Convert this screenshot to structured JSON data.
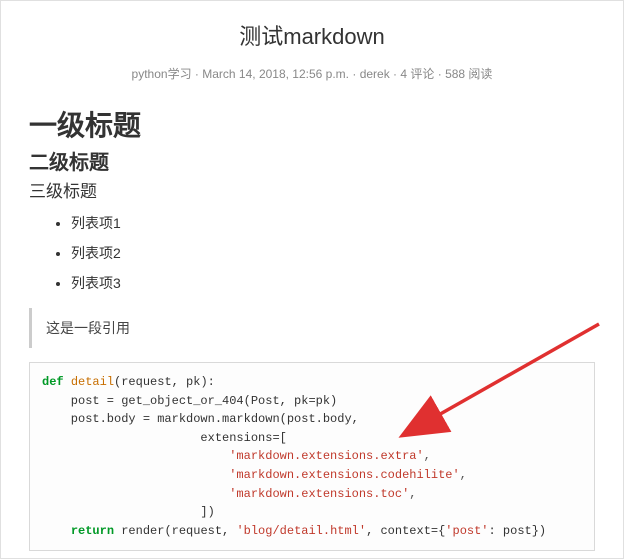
{
  "post": {
    "title": "测试markdown",
    "meta": {
      "category": "python学习",
      "date": "March 14, 2018, 12:56 p.m.",
      "author": "derek",
      "comments": "4 评论",
      "views": "588 阅读"
    },
    "headings": {
      "h1": "一级标题",
      "h2": "二级标题",
      "h3": "三级标题"
    },
    "list": [
      "列表项1",
      "列表项2",
      "列表项3"
    ],
    "quote": "这是一段引用",
    "code": {
      "kw_def": "def",
      "fn_detail": "detail",
      "params": "(request, pk):",
      "line2_pre": "    post = get_object_or_404(Post, pk=pk)",
      "line3_pre": "    post.body = markdown.markdown(post.body,",
      "line4_pre": "                      extensions=[",
      "str1": "'markdown.extensions.extra'",
      "str2": "'markdown.extensions.codehilite'",
      "str3": "'markdown.extensions.toc'",
      "line8_pre": "                      ])",
      "kw_return": "return",
      "ret_tail_a": " render(request, ",
      "ret_str": "'blog/detail.html'",
      "ret_tail_b": ", context={",
      "ret_str2": "'post'",
      "ret_tail_c": ": post})",
      "comma": ",",
      "indent_str": "                          "
    }
  }
}
